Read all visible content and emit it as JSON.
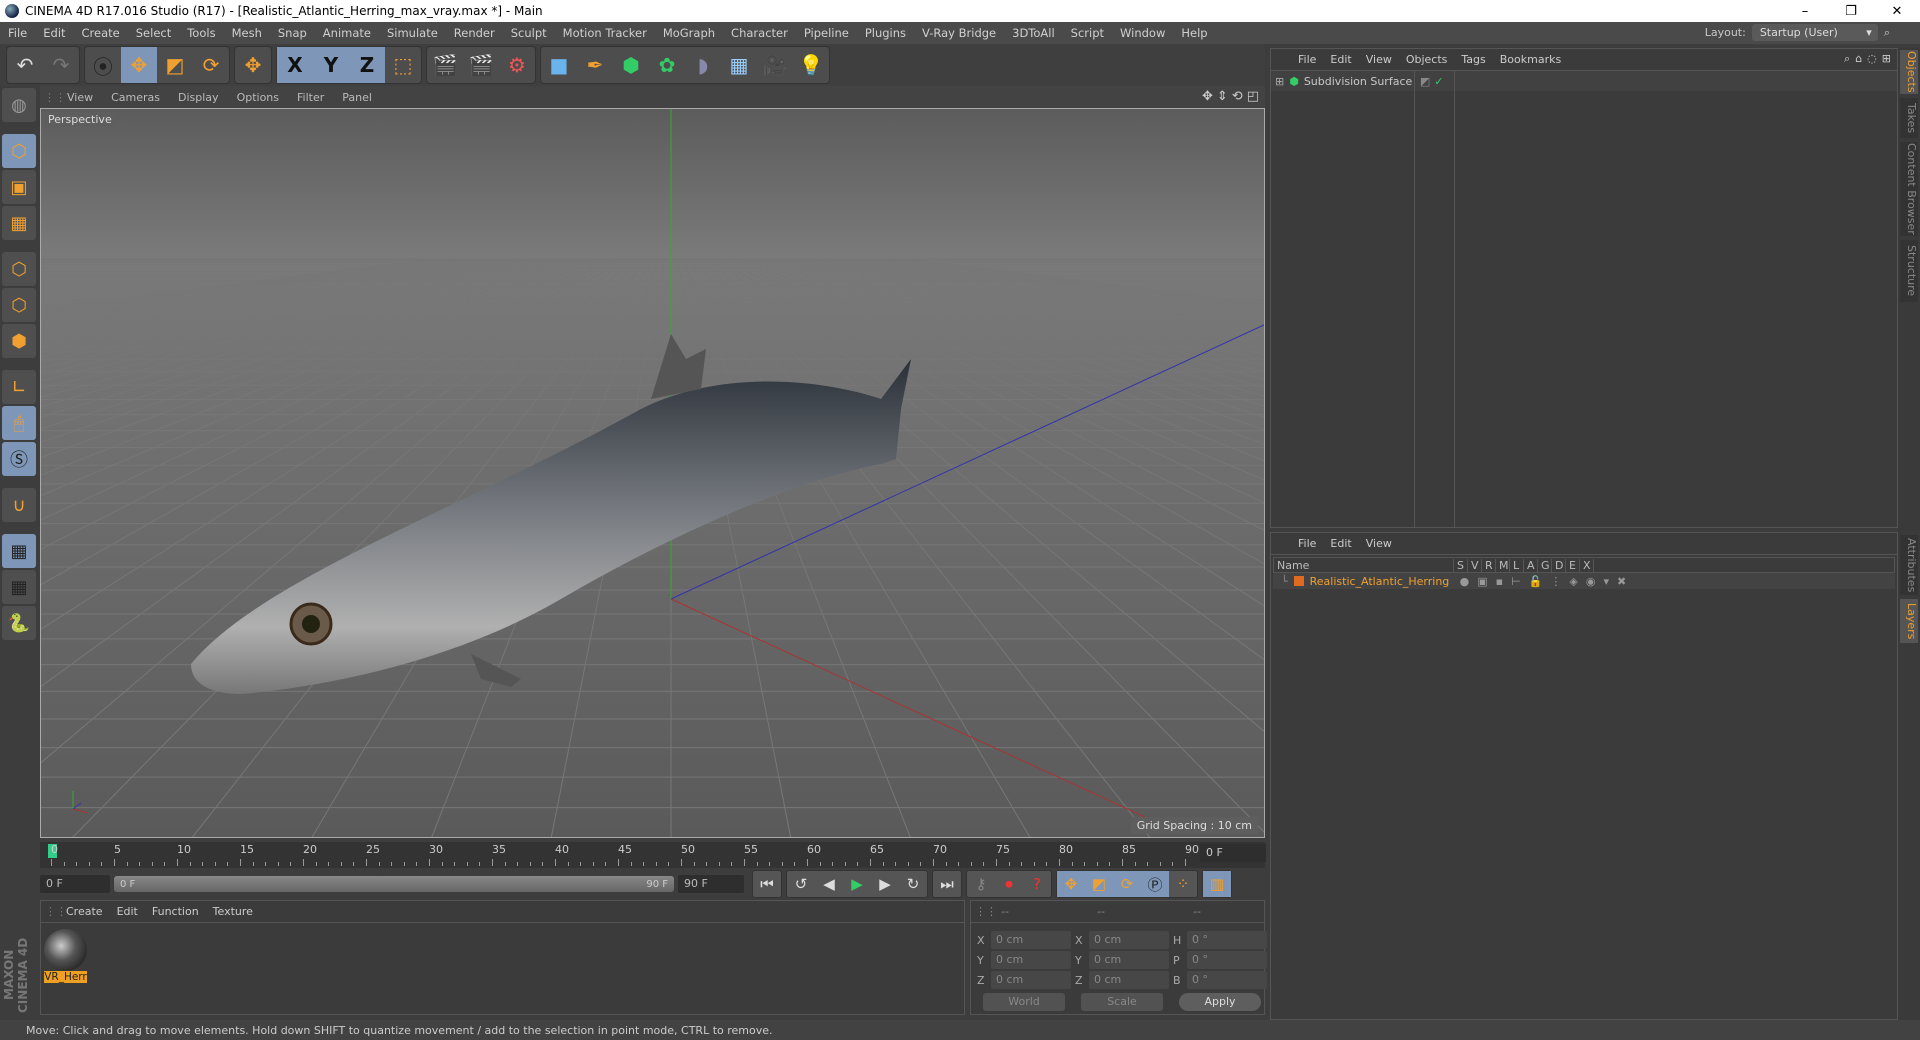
{
  "window": {
    "title": "CINEMA 4D R17.016 Studio (R17) - [Realistic_Atlantic_Herring_max_vray.max *] - Main",
    "minimize": "–",
    "maximize": "❐",
    "close": "✕"
  },
  "menubar": [
    "File",
    "Edit",
    "Create",
    "Select",
    "Tools",
    "Mesh",
    "Snap",
    "Animate",
    "Simulate",
    "Render",
    "Sculpt",
    "Motion Tracker",
    "MoGraph",
    "Character",
    "Pipeline",
    "Plugins",
    "V-Ray Bridge",
    "3DToAll",
    "Script",
    "Window",
    "Help"
  ],
  "layout": {
    "label": "Layout:",
    "value": "Startup (User)"
  },
  "toolbar": {
    "undo": "undo-icon",
    "redo": "redo-icon",
    "tools": [
      "live-selection",
      "move",
      "scale",
      "rotate",
      "recent-tool"
    ],
    "axes": [
      "X",
      "Y",
      "Z"
    ],
    "coord_system": "world-coordinate-icon",
    "render": [
      "render-view",
      "render-to-picture-viewer",
      "edit-render-settings"
    ],
    "create": [
      "cube",
      "pen",
      "subdivision-surface",
      "array",
      "deformer",
      "floor",
      "camera",
      "light"
    ]
  },
  "left_tools": [
    "make-editable",
    "model",
    "texture",
    "workplane",
    "points",
    "edges",
    "polygons",
    "axis",
    "tweak",
    "solo",
    "snapping",
    "locked-workplane",
    "planar-workplane",
    "python"
  ],
  "viewport": {
    "menu": [
      "View",
      "Cameras",
      "Display",
      "Options",
      "Filter",
      "Panel"
    ],
    "camera_label": "Perspective",
    "grid_spacing": "Grid Spacing : 10 cm"
  },
  "timeline": {
    "ticks": [
      "0",
      "5",
      "10",
      "15",
      "20",
      "25",
      "30",
      "35",
      "40",
      "45",
      "50",
      "55",
      "60",
      "65",
      "70",
      "75",
      "80",
      "85",
      "90"
    ],
    "current_frame": "0 F",
    "start_field": "0 F",
    "range_start": "0 F",
    "range_end": "90 F",
    "end_field": "90 F"
  },
  "materials": {
    "menu": [
      "Create",
      "Edit",
      "Function",
      "Texture"
    ],
    "items": [
      {
        "name": "VR_Herr"
      }
    ]
  },
  "branding": "MAXON CINEMA 4D",
  "coordinates": {
    "headers": [
      "--",
      "--",
      "--"
    ],
    "rows": [
      {
        "l1": "X",
        "v1": "0 cm",
        "l2": "X",
        "v2": "0 cm",
        "l3": "H",
        "v3": "0 °"
      },
      {
        "l1": "Y",
        "v1": "0 cm",
        "l2": "Y",
        "v2": "0 cm",
        "l3": "P",
        "v3": "0 °"
      },
      {
        "l1": "Z",
        "v1": "0 cm",
        "l2": "Z",
        "v2": "0 cm",
        "l3": "B",
        "v3": "0 °"
      }
    ],
    "space": "World",
    "mode": "Scale",
    "apply": "Apply"
  },
  "objects_panel": {
    "menu": [
      "File",
      "Edit",
      "View",
      "Objects",
      "Tags",
      "Bookmarks"
    ],
    "items": [
      {
        "name": "Subdivision Surface"
      }
    ]
  },
  "layers_panel": {
    "menu": [
      "File",
      "Edit",
      "View"
    ],
    "columns": [
      "Name",
      "S",
      "V",
      "R",
      "M",
      "L",
      "A",
      "G",
      "D",
      "E",
      "X"
    ],
    "items": [
      {
        "name": "Realistic_Atlantic_Herring",
        "color": "#e06a20"
      }
    ]
  },
  "side_tabs": {
    "top": [
      {
        "label": "Objects",
        "active": true
      },
      {
        "label": "Takes",
        "active": false
      },
      {
        "label": "Content Browser",
        "active": false
      },
      {
        "label": "Structure",
        "active": false
      }
    ],
    "bottom": [
      {
        "label": "Attributes",
        "active": false
      },
      {
        "label": "Layers",
        "active": true
      }
    ]
  },
  "status": "Move: Click and drag to move elements. Hold down SHIFT to quantize movement / add to the selection in point mode, CTRL to remove."
}
